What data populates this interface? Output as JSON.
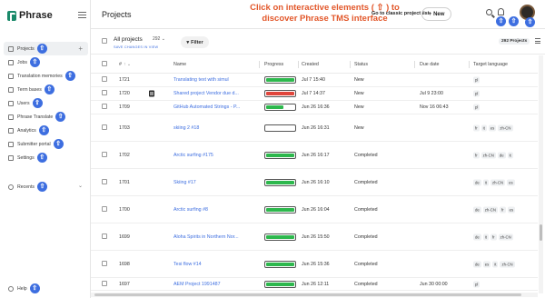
{
  "app": {
    "logo_text": "Phrase"
  },
  "sidebar": {
    "collapse_icon": "sidebar-collapse-icon",
    "items": [
      {
        "label": "Projects",
        "icon": "folder-icon",
        "active": true,
        "plus": "+"
      },
      {
        "label": "Jobs",
        "icon": "jobs-icon"
      },
      {
        "label": "Translation memories",
        "icon": "tm-icon"
      },
      {
        "label": "Term bases",
        "icon": "termbase-icon"
      },
      {
        "label": "Users",
        "icon": "users-icon"
      },
      {
        "label": "Phrase Translate",
        "icon": "translate-icon"
      },
      {
        "label": "Analytics",
        "icon": "analytics-icon"
      },
      {
        "label": "Submitter portal",
        "icon": "portal-icon"
      },
      {
        "label": "Settings",
        "icon": "gear-icon"
      }
    ],
    "recents": {
      "label": "Recents",
      "chevron": "⌄"
    },
    "help": {
      "label": "Help"
    }
  },
  "badge_glyph": "⇧",
  "header": {
    "title": "Projects",
    "banner": "Click on interactive elements ( ⇧ ) to discover Phrase TMS interface",
    "classic_link": "Go to classic project list",
    "new_label": "New",
    "new_plus": "+"
  },
  "toolbar": {
    "view_name": "All projects",
    "view_count": "292",
    "view_chevron": "⌄",
    "save_changes": "SAVE CHANGES IN VIEW",
    "filter_label": "Filter",
    "project_count": "292 Projects"
  },
  "table": {
    "headers": {
      "id": "#",
      "name": "Name",
      "progress": "Progress",
      "created": "Created",
      "status": "Status",
      "due": "Due date",
      "lang": "Target language"
    },
    "rows": [
      {
        "id": "1721",
        "icon": false,
        "name": "Translating text with simul",
        "progress": 1.0,
        "progress_color": "#2db84d",
        "created": "Jul 7 15:40",
        "status": "New",
        "due": "",
        "langs": [
          "pl"
        ],
        "height": 15
      },
      {
        "id": "1720",
        "icon": true,
        "name": "Shared project Vendor due d...",
        "progress": 1.0,
        "progress_color": "#e0463c",
        "created": "Jul 7 14:37",
        "status": "New",
        "due": "Jul 9 23:00",
        "langs": [
          "pl"
        ],
        "height": 15
      },
      {
        "id": "1709",
        "icon": false,
        "name": "GitHub Automated Strings - P...",
        "progress": 0.6,
        "progress_color": "#2db84d",
        "created": "Jun 26 16:36",
        "status": "New",
        "due": "Nov 16 06:43",
        "langs": [
          "pl"
        ],
        "height": 15
      },
      {
        "id": "1703",
        "icon": false,
        "name": "skiing 2 #18",
        "progress": 0.0,
        "progress_color": "#2db84d",
        "created": "Jun 26 16:31",
        "status": "New",
        "due": "",
        "langs": [
          "fr",
          "it",
          "es",
          "zh-CN"
        ],
        "height": 30
      },
      {
        "id": "1702",
        "icon": false,
        "name": "Arctic surfing #175",
        "progress": 1.0,
        "progress_color": "#2db84d",
        "created": "Jun 26 16:17",
        "status": "Completed",
        "due": "",
        "langs": [
          "fr",
          "zh-CN",
          "de",
          "it"
        ],
        "height": 30
      },
      {
        "id": "1701",
        "icon": false,
        "name": "Skiing #17",
        "progress": 1.0,
        "progress_color": "#2db84d",
        "created": "Jun 26 16:10",
        "status": "Completed",
        "due": "",
        "langs": [
          "de",
          "it",
          "zh-CN",
          "es"
        ],
        "height": 30
      },
      {
        "id": "1700",
        "icon": false,
        "name": "Arctic surfing #8",
        "progress": 1.0,
        "progress_color": "#2db84d",
        "created": "Jun 26 16:04",
        "status": "Completed",
        "due": "",
        "langs": [
          "de",
          "zh-CN",
          "fr",
          "es"
        ],
        "height": 30
      },
      {
        "id": "1699",
        "icon": false,
        "name": "Aloha Spirits in Northern Nor...",
        "progress": 1.0,
        "progress_color": "#2db84d",
        "created": "Jun 26 15:50",
        "status": "Completed",
        "due": "",
        "langs": [
          "de",
          "it",
          "fr",
          "zh-CN"
        ],
        "height": 30
      },
      {
        "id": "1698",
        "icon": false,
        "name": "Tesi flow #14",
        "progress": 1.0,
        "progress_color": "#2db84d",
        "created": "Jun 26 15:36",
        "status": "Completed",
        "due": "",
        "langs": [
          "de",
          "es",
          "it",
          "zh-CN"
        ],
        "height": 30
      },
      {
        "id": "1697",
        "icon": false,
        "name": "AEM Project 1991487",
        "progress": 1.0,
        "progress_color": "#2db84d",
        "created": "Jun 26 12:11",
        "status": "Completed",
        "due": "Jun 30 00:00",
        "langs": [
          "pl"
        ],
        "height": 14
      }
    ]
  },
  "colors": {
    "accent": "#3d6ee0",
    "banner": "#e2572a",
    "brand": "#1a8a6a",
    "progress_done": "#2db84d",
    "progress_overdue": "#e0463c"
  }
}
